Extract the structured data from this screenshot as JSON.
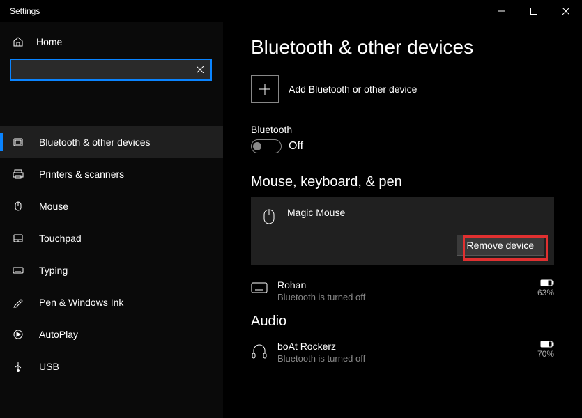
{
  "window_title": "Settings",
  "sidebar": {
    "home": "Home",
    "search_value": "",
    "items": [
      {
        "label": "Bluetooth & other devices"
      },
      {
        "label": "Printers & scanners"
      },
      {
        "label": "Mouse"
      },
      {
        "label": "Touchpad"
      },
      {
        "label": "Typing"
      },
      {
        "label": "Pen & Windows Ink"
      },
      {
        "label": "AutoPlay"
      },
      {
        "label": "USB"
      }
    ]
  },
  "main": {
    "title": "Bluetooth & other devices",
    "add_device": "Add Bluetooth or other device",
    "bt_label": "Bluetooth",
    "bt_state": "Off",
    "sections": {
      "mkp": {
        "heading": "Mouse, keyboard, & pen",
        "selected_device": {
          "name": "Magic  Mouse",
          "remove": "Remove device"
        },
        "device2": {
          "name": "Rohan",
          "status": "Bluetooth is turned off",
          "battery": "63%"
        }
      },
      "audio": {
        "heading": "Audio",
        "device1": {
          "name": "boAt Rockerz",
          "status": "Bluetooth is turned off",
          "battery": "70%"
        }
      }
    }
  }
}
